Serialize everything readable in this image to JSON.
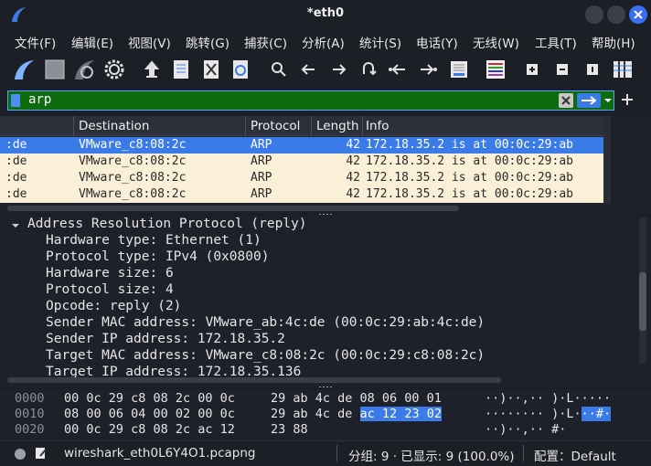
{
  "window": {
    "title": "*eth0"
  },
  "menu": [
    "文件(F)",
    "编辑(E)",
    "视图(V)",
    "跳转(G)",
    "捕获(C)",
    "分析(A)",
    "统计(S)",
    "电话(Y)",
    "无线(W)",
    "工具(T)",
    "帮助(H)"
  ],
  "filter": {
    "value": "arp"
  },
  "packet_list": {
    "columns": [
      "Destination",
      "Protocol",
      "Length",
      "Info"
    ],
    "rows": [
      {
        "source": ":de",
        "destination": "VMware_c8:08:2c",
        "protocol": "ARP",
        "length": "42",
        "info": "172.18.35.2 is at 00:0c:29:ab",
        "selected": true
      },
      {
        "source": ":de",
        "destination": "VMware_c8:08:2c",
        "protocol": "ARP",
        "length": "42",
        "info": "172.18.35.2 is at 00:0c:29:ab",
        "selected": false
      },
      {
        "source": ":de",
        "destination": "VMware_c8:08:2c",
        "protocol": "ARP",
        "length": "42",
        "info": "172.18.35.2 is at 00:0c:29:ab",
        "selected": false
      },
      {
        "source": ":de",
        "destination": "VMware_c8:08:2c",
        "protocol": "ARP",
        "length": "42",
        "info": "172.18.35.2 is at 00:0c:29:ab",
        "selected": false
      }
    ]
  },
  "details": {
    "header": "Address Resolution Protocol (reply)",
    "fields": [
      "Hardware type: Ethernet (1)",
      "Protocol type: IPv4 (0x0800)",
      "Hardware size: 6",
      "Protocol size: 4",
      "Opcode: reply (2)",
      "Sender MAC address: VMware_ab:4c:de (00:0c:29:ab:4c:de)",
      "Sender IP address: 172.18.35.2",
      "Target MAC address: VMware_c8:08:2c (00:0c:29:c8:08:2c)",
      "Target IP address: 172.18.35.136"
    ]
  },
  "bytes": {
    "rows": [
      {
        "offset": "0000",
        "hex1": "00 0c 29 c8 08 2c 00 0c",
        "hex2": "29 ab 4c de 08 06 00 01",
        "hex2_hl": "",
        "ascii": "··)··,·· )·L·····",
        "ascii_hl": ""
      },
      {
        "offset": "0010",
        "hex1": "08 00 06 04 00 02 00 0c",
        "hex2": "29 ab 4c de ",
        "hex2_hl": "ac 12 23 02",
        "ascii": "········ )·L·",
        "ascii_hl": "··#·"
      },
      {
        "offset": "0020",
        "hex1": "00 0c 29 c8 08 2c ac 12",
        "hex2": "23 88",
        "hex2_hl": "",
        "ascii": "··)··,·· #·",
        "ascii_hl": ""
      }
    ]
  },
  "status": {
    "file": "wireshark_eth0L6Y4O1.pcapng",
    "packets": "分组: 9 · 已显示: 9 (100.0%)",
    "profile": "配置：Default"
  },
  "colors": {
    "accent": "#3b7be8",
    "filter_ok": "#0e6b0e",
    "row_bg": "#faf0d7"
  }
}
